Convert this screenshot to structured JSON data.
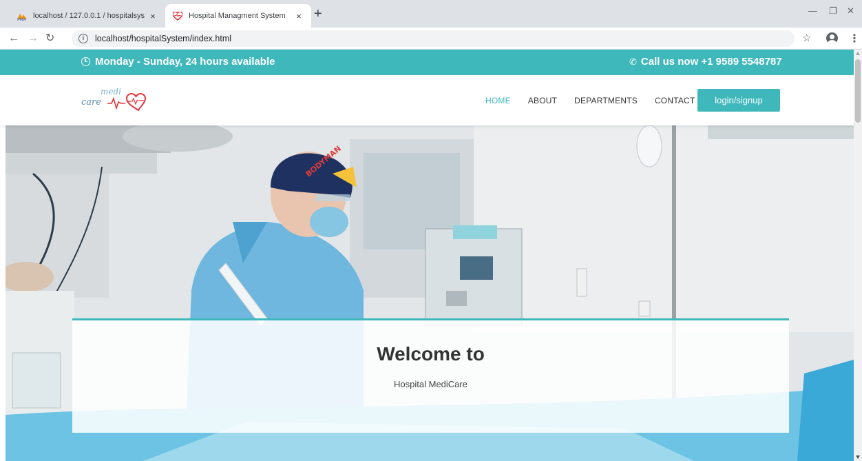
{
  "browser": {
    "tabs": [
      {
        "title": "localhost / 127.0.0.1 / hospitalsys",
        "favicon": "phpmyadmin-icon",
        "active": false
      },
      {
        "title": "Hospital Managment System",
        "favicon": "heart-icon",
        "active": true
      }
    ],
    "close_glyph": "×",
    "new_tab_glyph": "+",
    "address": "localhost/hospitalSystem/index.html",
    "info_glyph": "i"
  },
  "topbar": {
    "hours": "Monday - Sunday, 24 hours available",
    "phone": "Call us now +1 9589 5548787",
    "color": "#3fb8bb"
  },
  "logo": {
    "line1": "medi",
    "line2": "care"
  },
  "nav": {
    "items": [
      {
        "label": "HOME",
        "active": true
      },
      {
        "label": "ABOUT",
        "active": false
      },
      {
        "label": "DEPARTMENTS",
        "active": false
      },
      {
        "label": "CONTACT",
        "active": false
      }
    ],
    "login_label": "login/signup"
  },
  "hero": {
    "title": "Welcome to",
    "subtitle": "Hospital MediCare",
    "cap_text": "BODYMAN"
  }
}
